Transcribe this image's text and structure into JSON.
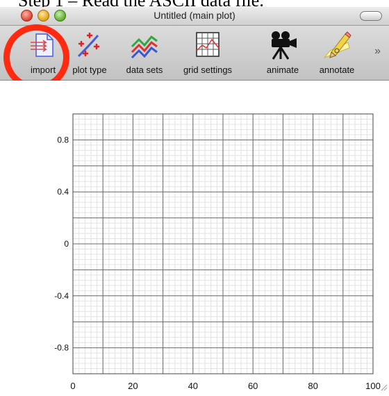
{
  "caption": "Step 1 – Read the ASCII data file.",
  "window": {
    "title": "Untitled (main plot)"
  },
  "toolbar": {
    "items": [
      {
        "label": "import",
        "icon": "import-icon"
      },
      {
        "label": "plot type",
        "icon": "plot-type-icon"
      },
      {
        "label": "data sets",
        "icon": "data-sets-icon"
      },
      {
        "label": "grid settings",
        "icon": "grid-settings-icon"
      },
      {
        "label": "animate",
        "icon": "camera-icon"
      },
      {
        "label": "annotate",
        "icon": "pencil-icon"
      }
    ],
    "overflow": "»"
  },
  "highlight_color": "#ff2a10",
  "chart_data": {
    "type": "line",
    "series": [],
    "xlim": [
      0,
      100
    ],
    "ylim": [
      -1,
      1
    ],
    "xticks": [
      0,
      20,
      40,
      60,
      80,
      100
    ],
    "yticks": [
      0.8,
      0.4,
      0,
      -0.4,
      -0.8
    ],
    "xtick_labels": [
      "0",
      "20",
      "40",
      "60",
      "80",
      "100"
    ],
    "ytick_labels": [
      "0.8",
      "0.4",
      "0",
      "-0.4",
      "-0.8"
    ],
    "grid": true,
    "title": "",
    "xlabel": "",
    "ylabel": ""
  }
}
